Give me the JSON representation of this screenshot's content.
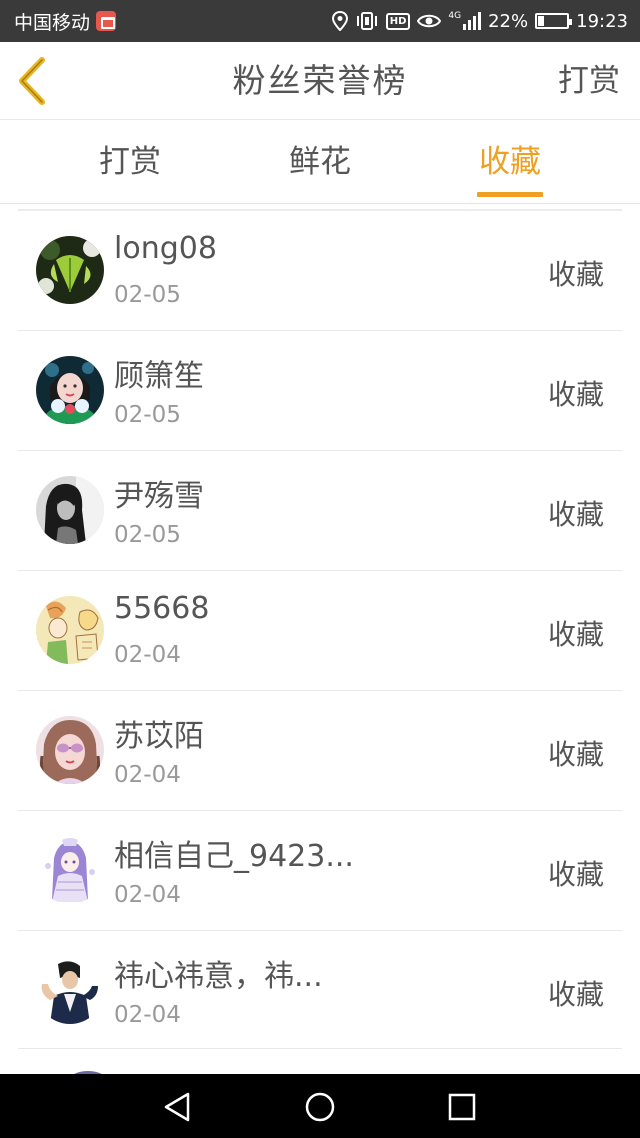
{
  "status_bar": {
    "carrier": "中国移动",
    "battery_percent": "22%",
    "battery_level": 0.22,
    "hd_badge": "HD",
    "network_type": "4G",
    "time": "19:23",
    "icons": [
      "location-icon",
      "vibrate-icon",
      "hd-icon",
      "eye-icon",
      "signal-icon",
      "battery-icon"
    ]
  },
  "header": {
    "title": "粉丝荣誉榜",
    "action_label": "打赏",
    "back_icon": "chevron-left-icon"
  },
  "tabs": [
    {
      "label": "打赏",
      "active": false
    },
    {
      "label": "鲜花",
      "active": false
    },
    {
      "label": "收藏",
      "active": true
    }
  ],
  "colors": {
    "accent": "#f0a020",
    "text_primary": "#555555",
    "text_secondary": "#999999",
    "divider": "#e9e9e9",
    "status_bar": "#3a3a3a",
    "nav_bar": "#000000"
  },
  "fans": [
    {
      "name": "long08",
      "date": "02-05",
      "action": "收藏",
      "avatar": "ginkgo-leaf-avatar"
    },
    {
      "name": "顾箫笙",
      "date": "02-05",
      "action": "收藏",
      "avatar": "girl-green-avatar"
    },
    {
      "name": "尹殇雪",
      "date": "02-05",
      "action": "收藏",
      "avatar": "monochrome-girl-avatar"
    },
    {
      "name": "55668",
      "date": "02-04",
      "action": "收藏",
      "avatar": "anime-sketch-avatar"
    },
    {
      "name": "苏苡陌",
      "date": "02-04",
      "action": "收藏",
      "avatar": "girl-sunglasses-avatar"
    },
    {
      "name": "相信自己_9423...",
      "date": "02-04",
      "action": "收藏",
      "avatar": "anime-purple-avatar"
    },
    {
      "name": "祎心祎意，祎...",
      "date": "02-04",
      "action": "收藏",
      "avatar": "man-pose-avatar"
    }
  ],
  "nav_bar": {
    "buttons": [
      "back-triangle-icon",
      "home-circle-icon",
      "recents-square-icon"
    ]
  }
}
